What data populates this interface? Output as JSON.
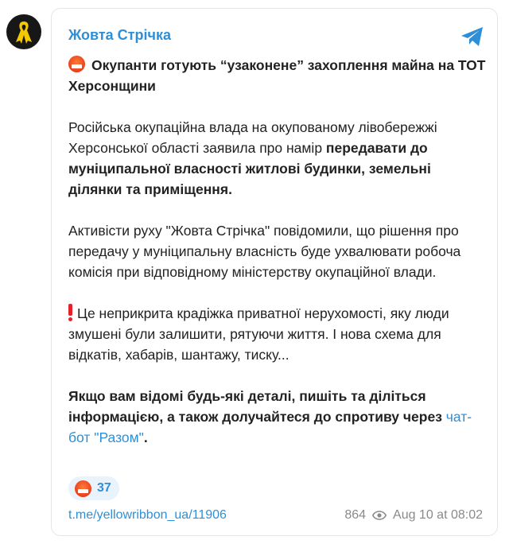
{
  "channel": {
    "name": "Жовта Стрічка"
  },
  "icons": {
    "avatar": "yellow-ribbon-icon",
    "share": "telegram-icon",
    "views": "eye-icon",
    "emoji": "angry-face-emoji",
    "alert": "exclamation-emoji"
  },
  "colors": {
    "link": "#2f8fd6",
    "ribbon": "#f5c800",
    "avatar_bg": "#171717",
    "reaction_bg": "#e9f3fb"
  },
  "post": {
    "title": "Окупанти готують “узаконене” захоплення майна на ТОТ Херсонщини",
    "p1_start": "Російська окупаційна влада на окупованому лівобережжі Херсонської області заявила про намір ",
    "p1_bold": "передавати до муніципальної власності житлові будинки, земельні ділянки та приміщення.",
    "p2": "Активісти руху \"Жовта Стрічка\" повідомили, що рішення про передачу у муніципальну власність буде ухвалювати робоча комісія при відповідному міністерству окупаційної влади.",
    "p3": "Це неприкрита крадіжка приватної нерухомості, яку люди змушені були залишити, рятуючи життя. І нова схема для відкатів, хабарів, шантажу, тиску...",
    "p4_bold": "Якщо вам відомі будь-які деталі, пишіть та діліться інформацією, а також долучайтеся до спротиву через ",
    "p4_link": "чат-бот \"Разом\"",
    "p4_end": "."
  },
  "reaction": {
    "count": "37"
  },
  "footer": {
    "link": "t.me/yellowribbon_ua/11906",
    "views": "864",
    "date": "Aug 10 at 08:02"
  }
}
